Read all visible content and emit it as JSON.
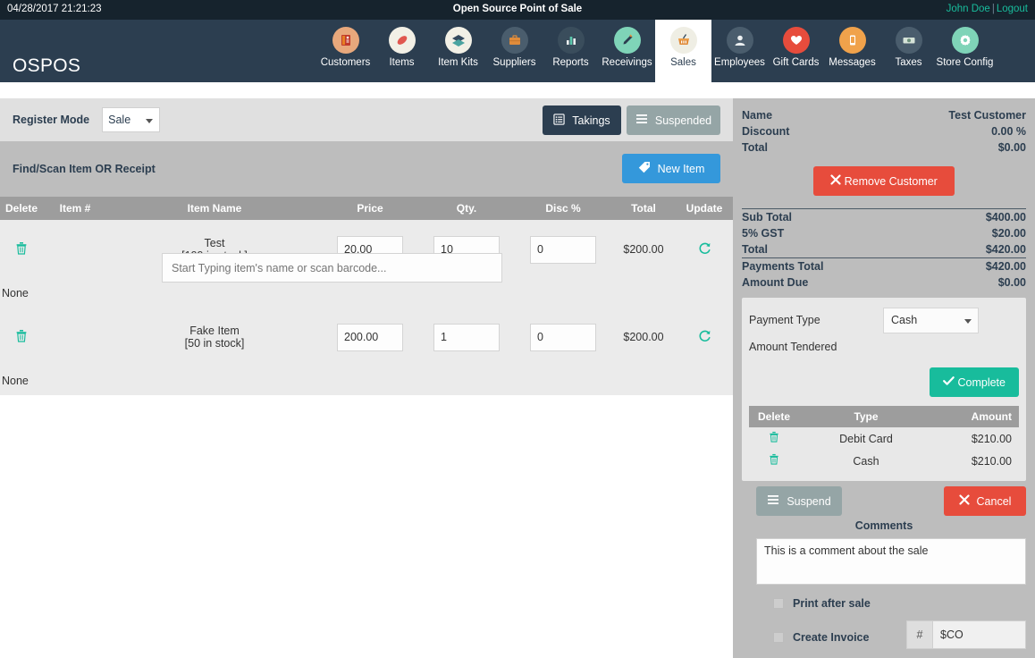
{
  "topbar": {
    "datetime": "04/28/2017 21:21:23",
    "title": "Open Source Point of Sale",
    "user": "John Doe",
    "separator": "|",
    "logout": "Logout"
  },
  "nav": {
    "brand": "OSPOS",
    "items": [
      {
        "label": "Customers",
        "icon": "customers-icon",
        "glyph": "▤",
        "active": false
      },
      {
        "label": "Items",
        "icon": "items-icon",
        "glyph": "◆",
        "active": false
      },
      {
        "label": "Item Kits",
        "icon": "item-kits-icon",
        "glyph": "❖",
        "active": false
      },
      {
        "label": "Suppliers",
        "icon": "suppliers-icon",
        "glyph": "ὋC",
        "active": false
      },
      {
        "label": "Reports",
        "icon": "reports-icon",
        "glyph": "ὌA",
        "active": false
      },
      {
        "label": "Receivings",
        "icon": "receivings-icon",
        "glyph": "✎",
        "active": false
      },
      {
        "label": "Sales",
        "icon": "sales-basket-icon",
        "glyph": "Ὥ2",
        "active": true
      },
      {
        "label": "Employees",
        "icon": "employees-icon",
        "glyph": "὆4",
        "active": false
      },
      {
        "label": "Gift Cards",
        "icon": "gift-cards-icon",
        "glyph": "♥",
        "active": false
      },
      {
        "label": "Messages",
        "icon": "messages-icon",
        "glyph": "὏1",
        "active": false
      },
      {
        "label": "Taxes",
        "icon": "taxes-icon",
        "glyph": "Ὃ5",
        "active": false
      },
      {
        "label": "Store Config",
        "icon": "store-config-icon",
        "glyph": "⚙",
        "active": false
      }
    ]
  },
  "register": {
    "label": "Register Mode",
    "mode_value": "Sale",
    "takings_label": "Takings",
    "suspended_label": "Suspended"
  },
  "find": {
    "label": "Find/Scan Item OR Receipt",
    "placeholder": "Start Typing item's name or scan barcode...",
    "value": "",
    "new_item_label": "New Item"
  },
  "items_table": {
    "headers": [
      "Delete",
      "Item #",
      "Item Name",
      "Price",
      "Qty.",
      "Disc %",
      "Total",
      "Update"
    ],
    "rows": [
      {
        "item_number": "",
        "name": "Test",
        "stock": "[199 in stock]",
        "price": "20.00",
        "qty": "10",
        "disc": "0",
        "total": "$200.00",
        "note": "None"
      },
      {
        "item_number": "",
        "name": "Fake Item",
        "stock": "[50 in stock]",
        "price": "200.00",
        "qty": "1",
        "disc": "0",
        "total": "$200.00",
        "note": "None"
      }
    ]
  },
  "customer": {
    "name_label": "Name",
    "name_value": "Test Customer",
    "discount_label": "Discount",
    "discount_value": "0.00 %",
    "total_label": "Total",
    "total_value": "$0.00",
    "remove_label": "Remove Customer"
  },
  "totals": {
    "sub_total_label": "Sub Total",
    "sub_total_value": "$400.00",
    "tax_label": "5% GST",
    "tax_value": "$20.00",
    "total_label": "Total",
    "total_value": "$420.00",
    "payments_total_label": "Payments Total",
    "payments_total_value": "$420.00",
    "amount_due_label": "Amount Due",
    "amount_due_value": "$0.00"
  },
  "payment": {
    "type_label": "Payment Type",
    "type_value": "Cash",
    "tendered_label": "Amount Tendered",
    "tendered_value": "",
    "complete_label": "Complete"
  },
  "payments_table": {
    "headers": [
      "Delete",
      "Type",
      "Amount"
    ],
    "rows": [
      {
        "type": "Debit Card",
        "amount": "$210.00"
      },
      {
        "type": "Cash",
        "amount": "$210.00"
      }
    ]
  },
  "actions": {
    "suspend_label": "Suspend",
    "cancel_label": "Cancel"
  },
  "comments": {
    "label": "Comments",
    "value": "This is a comment about the sale"
  },
  "options": {
    "print_after_sale_label": "Print after sale",
    "print_after_sale_checked": false,
    "create_invoice_label": "Create Invoice",
    "create_invoice_checked": false,
    "invoice_prefix": "#",
    "invoice_value": "$CO"
  },
  "colors": {
    "topbar": "#16232d",
    "navbar": "#2c3e50",
    "accent_teal": "#18bc9c",
    "danger": "#e74c3c",
    "info": "#3498db",
    "muted": "#95a5a6"
  }
}
